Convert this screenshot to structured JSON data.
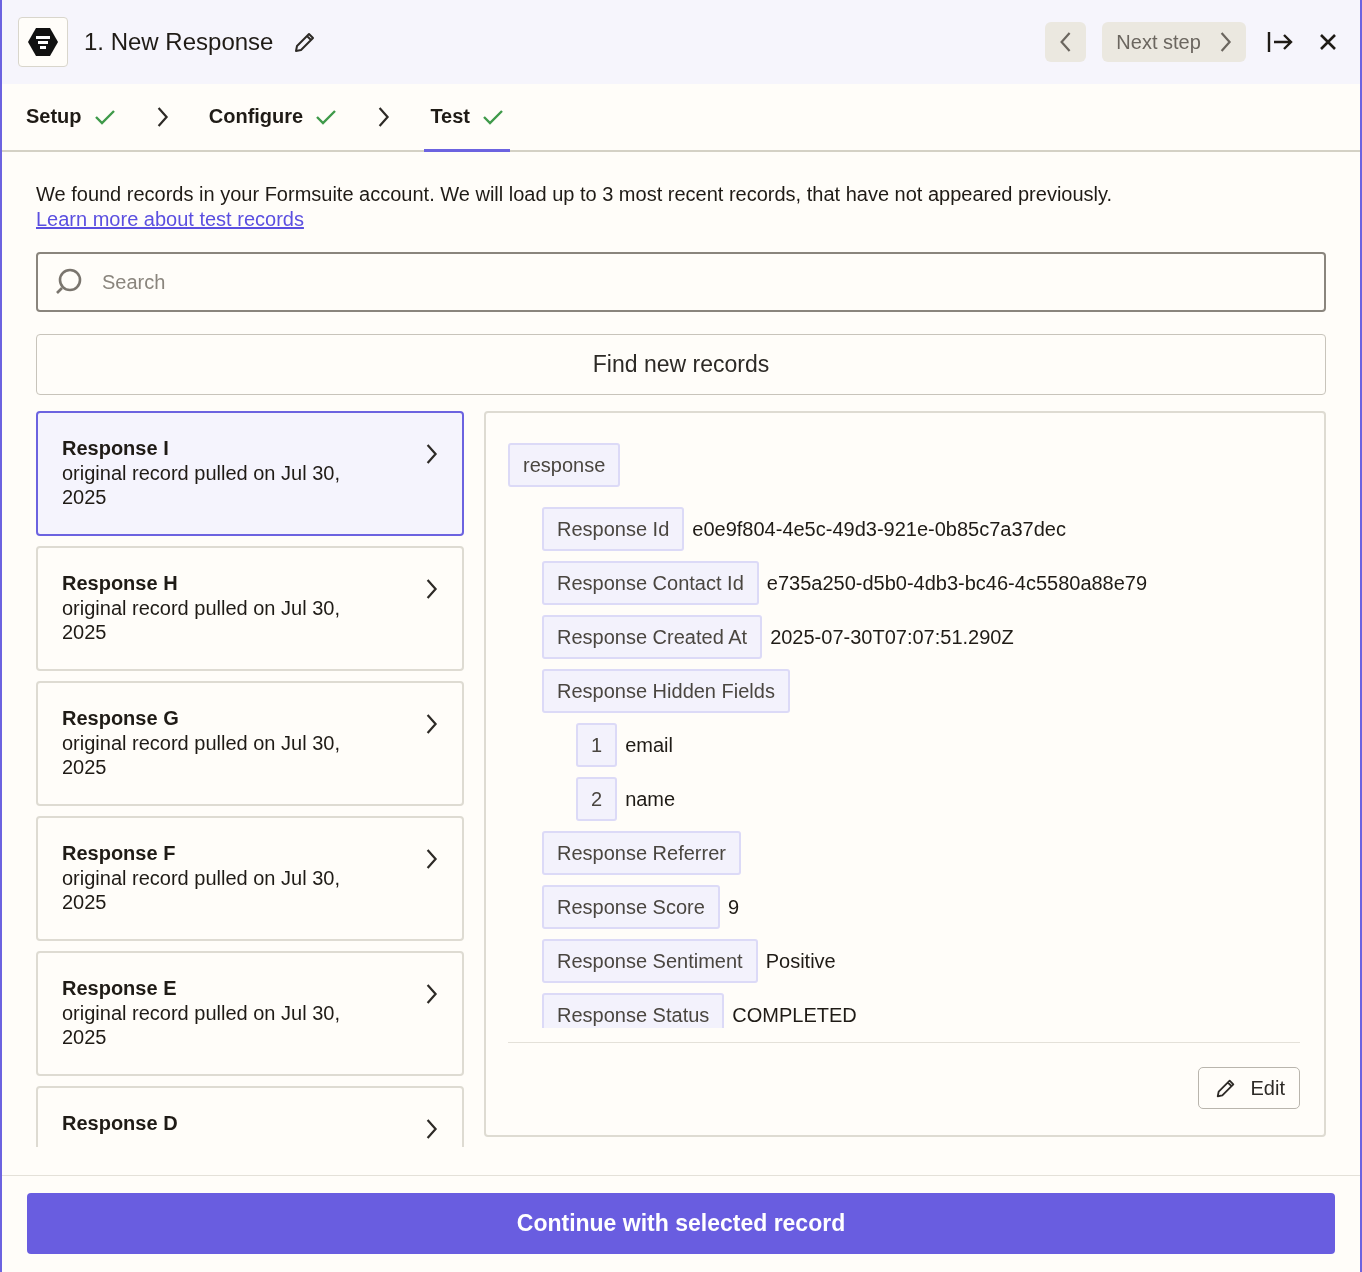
{
  "header": {
    "title": "1. New Response",
    "next_label": "Next step"
  },
  "steps": [
    {
      "label": "Setup",
      "done": true,
      "selected": false
    },
    {
      "label": "Configure",
      "done": true,
      "selected": false
    },
    {
      "label": "Test",
      "done": true,
      "selected": true
    }
  ],
  "intro": {
    "text": "We found records in your Formsuite account. We will load up to 3 most recent records, that have not appeared previously.",
    "link": "Learn more about test records"
  },
  "search": {
    "placeholder": "Search"
  },
  "find_button": "Find new records",
  "records": [
    {
      "title": "Response I",
      "subtitle": "original record pulled on Jul 30, 2025",
      "selected": true
    },
    {
      "title": "Response H",
      "subtitle": "original record pulled on Jul 30, 2025",
      "selected": false
    },
    {
      "title": "Response G",
      "subtitle": "original record pulled on Jul 30, 2025",
      "selected": false
    },
    {
      "title": "Response F",
      "subtitle": "original record pulled on Jul 30, 2025",
      "selected": false
    },
    {
      "title": "Response E",
      "subtitle": "original record pulled on Jul 30, 2025",
      "selected": false
    },
    {
      "title": "Response D",
      "selected": false
    }
  ],
  "details": {
    "root": "response",
    "fields": [
      {
        "key": "Response Id",
        "value": "e0e9f804-4e5c-49d3-921e-0b85c7a37dec"
      },
      {
        "key": "Response Contact Id",
        "value": "e735a250-d5b0-4db3-bc46-4c5580a88e79"
      },
      {
        "key": "Response Created At",
        "value": "2025-07-30T07:07:51.290Z"
      },
      {
        "key": "Response Hidden Fields",
        "children": [
          {
            "key": "1",
            "value": "email"
          },
          {
            "key": "2",
            "value": "name"
          }
        ]
      },
      {
        "key": "Response Referrer"
      },
      {
        "key": "Response Score",
        "value": "9"
      },
      {
        "key": "Response Sentiment",
        "value": "Positive"
      },
      {
        "key": "Response Status",
        "value": "COMPLETED"
      }
    ],
    "edit_button": "Edit"
  },
  "continue_button": "Continue with selected record"
}
